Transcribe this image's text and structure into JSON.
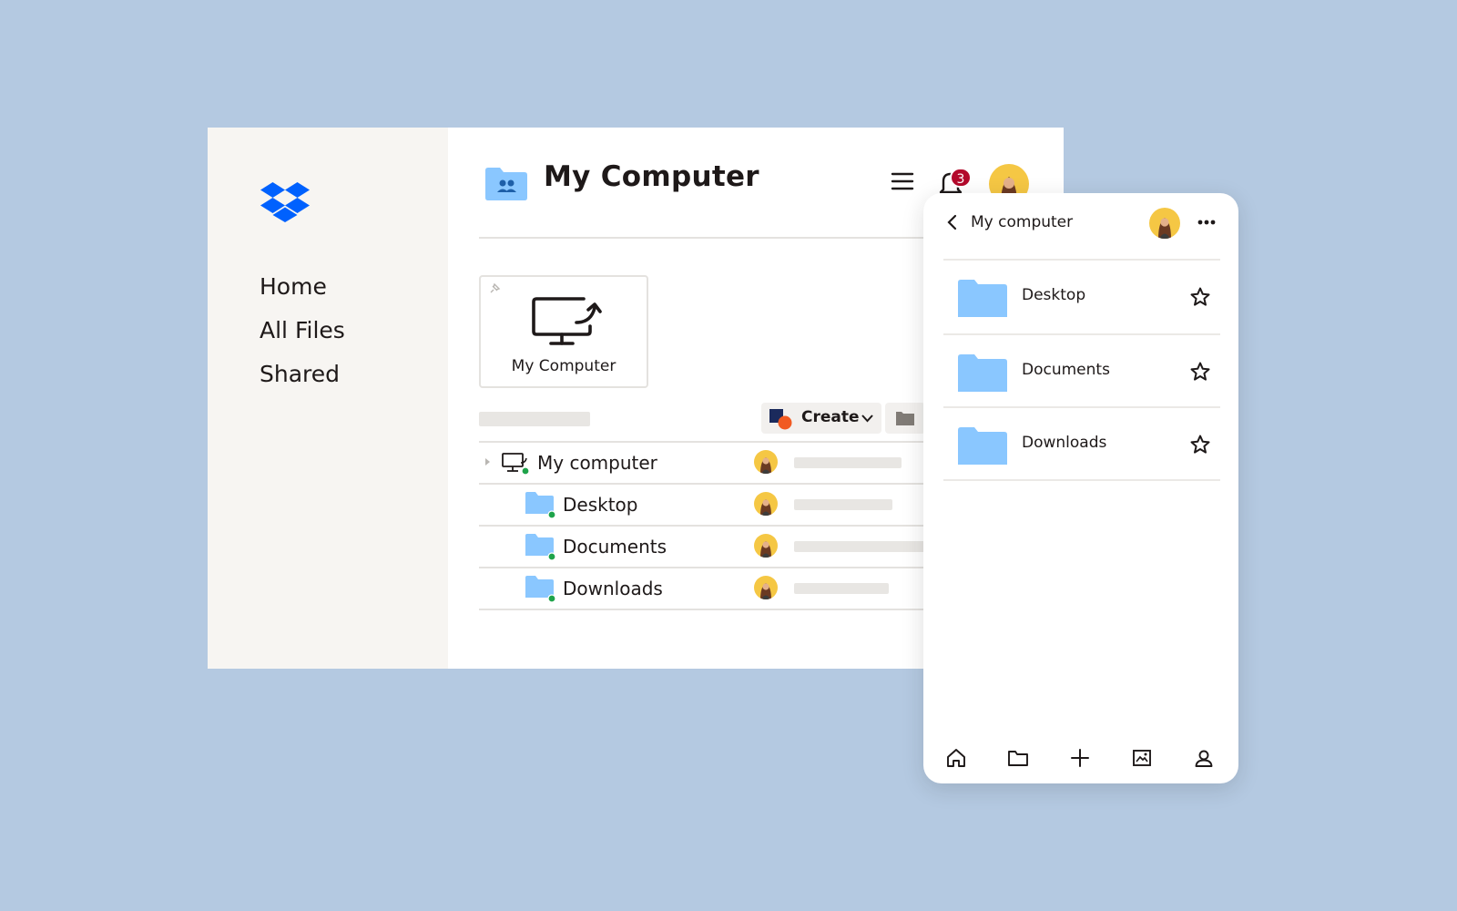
{
  "colors": {
    "background": "#b4c9e1",
    "sidebar": "#f7f5f2",
    "brand_blue": "#0061fe",
    "folder_blue": "#8ac7ff",
    "badge_red": "#b3092b",
    "avatar_yellow": "#f5c744",
    "sync_green": "#1ea34a"
  },
  "desktop": {
    "logo": "dropbox-logo",
    "nav": [
      {
        "label": "Home"
      },
      {
        "label": "All Files"
      },
      {
        "label": "Shared"
      }
    ],
    "header": {
      "title": "My Computer",
      "menu_icon": "hamburger-icon",
      "notification_icon": "bell-icon",
      "notification_count": "3"
    },
    "card": {
      "label": "My Computer",
      "icon": "monitor-upload-icon"
    },
    "toolbar": {
      "create_label": "Create",
      "create_icon": "create-shapes-icon",
      "folder_icon": "folder-icon"
    },
    "rows": [
      {
        "name": "My computer",
        "icon": "computer-icon",
        "synced": true
      },
      {
        "name": "Desktop",
        "icon": "folder-icon",
        "synced": true
      },
      {
        "name": "Documents",
        "icon": "folder-icon",
        "synced": true
      },
      {
        "name": "Downloads",
        "icon": "folder-icon",
        "synced": true
      }
    ]
  },
  "mobile": {
    "title": "My computer",
    "back_icon": "chevron-left-icon",
    "more_icon": "more-dots-icon",
    "folders": [
      {
        "name": "Desktop",
        "starred": false
      },
      {
        "name": "Documents",
        "starred": false
      },
      {
        "name": "Downloads",
        "starred": false
      }
    ],
    "tabs": [
      "home-icon",
      "folder-icon",
      "plus-icon",
      "photos-icon",
      "account-icon"
    ]
  }
}
